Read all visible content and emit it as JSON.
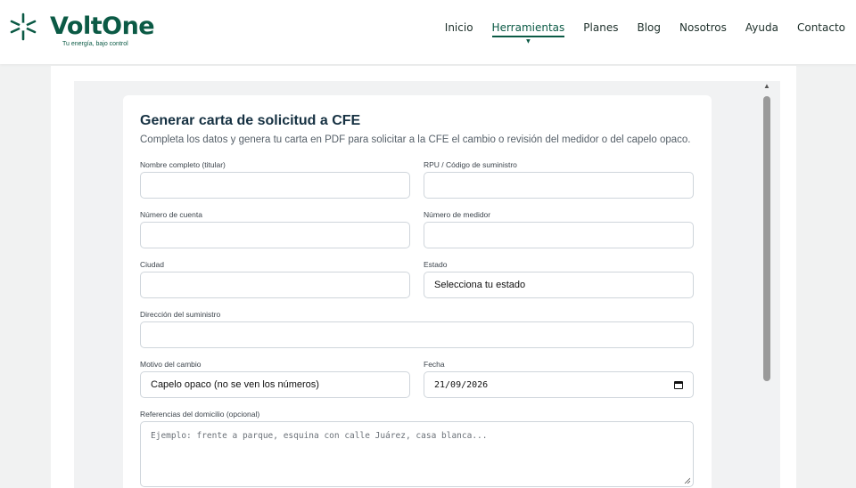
{
  "brand": {
    "name": "VoltOne",
    "tagline": "Tu energía, bajo control",
    "color": "#0b5a45"
  },
  "nav": {
    "items": [
      {
        "label": "Inicio",
        "active": false
      },
      {
        "label": "Herramientas",
        "active": true
      },
      {
        "label": "Planes",
        "active": false
      },
      {
        "label": "Blog",
        "active": false
      },
      {
        "label": "Nosotros",
        "active": false
      },
      {
        "label": "Ayuda",
        "active": false
      },
      {
        "label": "Contacto",
        "active": false
      }
    ]
  },
  "form": {
    "title": "Generar carta de solicitud a CFE",
    "subtitle": "Completa los datos y genera tu carta en PDF para solicitar a la CFE el cambio o revisión del medidor o del capelo opaco.",
    "fields": {
      "nombre": {
        "label": "Nombre completo (titular)",
        "value": ""
      },
      "rpu": {
        "label": "RPU / Código de suministro",
        "value": ""
      },
      "cuenta": {
        "label": "Número de cuenta",
        "value": ""
      },
      "medidor": {
        "label": "Número de medidor",
        "value": ""
      },
      "ciudad": {
        "label": "Ciudad",
        "value": ""
      },
      "estado": {
        "label": "Estado",
        "value": "Selecciona tu estado"
      },
      "direccion": {
        "label": "Dirección del suministro",
        "value": ""
      },
      "motivo": {
        "label": "Motivo del cambio",
        "value": "Capelo opaco (no se ven los números)"
      },
      "fecha": {
        "label": "Fecha",
        "value": "21/09/2026"
      },
      "referencias": {
        "label": "Referencias del domicilio (opcional)",
        "placeholder": "Ejemplo: frente a parque, esquina con calle Juárez, casa blanca..."
      }
    }
  },
  "icons": {
    "logo": "sparkle-burst-icon",
    "calendar": "calendar-icon",
    "resize": "resize-handle-icon",
    "scroll_up": "triangle-up-icon"
  }
}
